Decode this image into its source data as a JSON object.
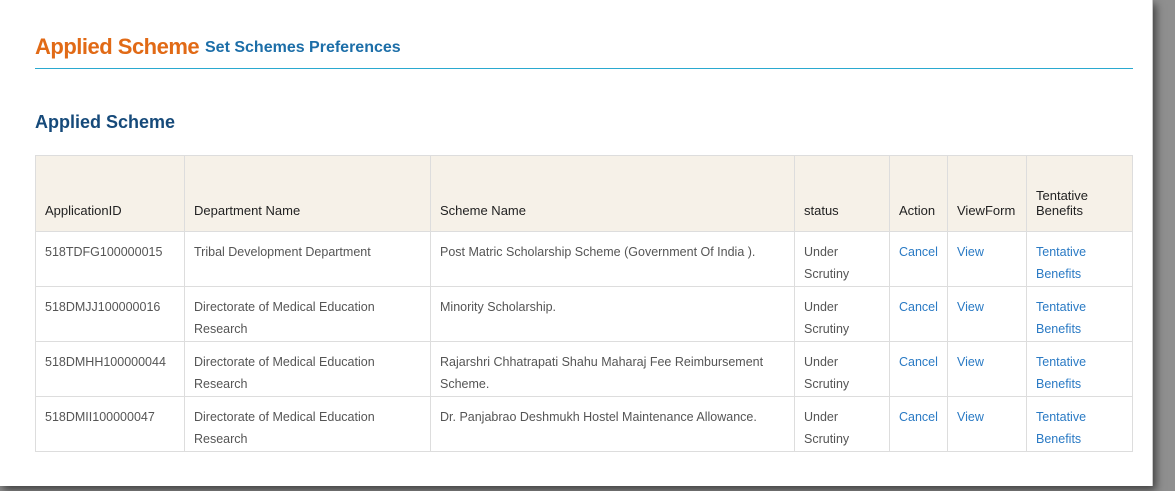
{
  "header": {
    "title": "Applied Scheme",
    "link": "Set Schemes Preferences"
  },
  "section_title": "Applied Scheme",
  "table": {
    "columns": [
      "ApplicationID",
      "Department Name",
      "Scheme Name",
      "status",
      "Action",
      "ViewForm",
      "Tentative Benefits"
    ],
    "rows": [
      {
        "id": "518TDFG100000015",
        "department": "Tribal Development Department",
        "scheme": "Post Matric Scholarship Scheme (Government Of India ).",
        "status": "Under Scrutiny",
        "action": "Cancel",
        "view": "View",
        "benefits": "Tentative Benefits"
      },
      {
        "id": "518DMJJ100000016",
        "department": "Directorate of Medical Education Research",
        "scheme": "Minority Scholarship.",
        "status": "Under Scrutiny",
        "action": "Cancel",
        "view": "View",
        "benefits": "Tentative Benefits"
      },
      {
        "id": "518DMHH100000044",
        "department": "Directorate of Medical Education Research",
        "scheme": "Rajarshri Chhatrapati Shahu Maharaj Fee Reimbursement Scheme.",
        "status": "Under Scrutiny",
        "action": "Cancel",
        "view": "View",
        "benefits": "Tentative Benefits"
      },
      {
        "id": "518DMII100000047",
        "department": "Directorate of Medical Education Research",
        "scheme": "Dr. Panjabrao Deshmukh Hostel Maintenance Allowance.",
        "status": "Under Scrutiny",
        "action": "Cancel",
        "view": "View",
        "benefits": "Tentative Benefits"
      }
    ]
  }
}
